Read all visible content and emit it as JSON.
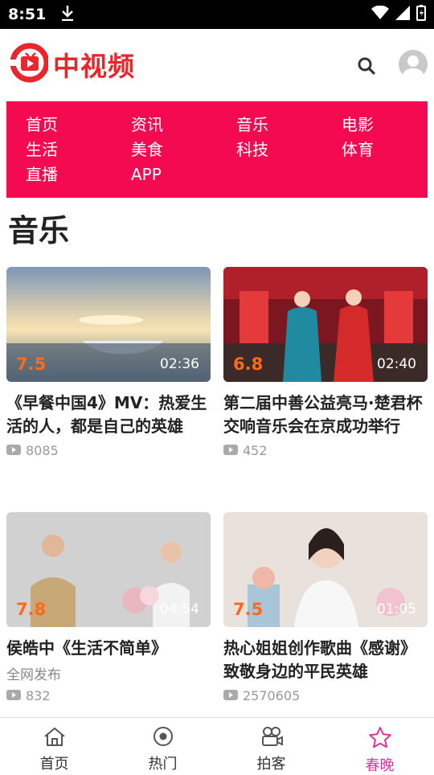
{
  "status": {
    "time": "8:51"
  },
  "app": {
    "name": "中视频"
  },
  "nav": [
    "首页",
    "资讯",
    "音乐",
    "电影",
    "生活",
    "美食",
    "科技",
    "体育",
    "直播",
    "APP"
  ],
  "section": {
    "title": "音乐"
  },
  "videos": [
    {
      "score": "7.5",
      "duration": "02:36",
      "title": "《早餐中国4》MV：热爱生活的人，都是自己的英雄",
      "subtitle": "",
      "views": "8085"
    },
    {
      "score": "6.8",
      "duration": "02:40",
      "title": "第二届中善公益亮马·楚君杯交响音乐会在京成功举行",
      "subtitle": "",
      "views": "452"
    },
    {
      "score": "7.8",
      "duration": "04:54",
      "title": "侯皓中《生活不简单》",
      "subtitle": "全网发布",
      "views": "832"
    },
    {
      "score": "7.5",
      "duration": "01:05",
      "title": "热心姐姐创作歌曲《感谢》致敬身边的平民英雄",
      "subtitle": "",
      "views": "2570605"
    }
  ],
  "tabs": [
    {
      "label": "首页",
      "icon": "home-icon"
    },
    {
      "label": "热门",
      "icon": "hot-icon"
    },
    {
      "label": "拍客",
      "icon": "camera-icon"
    },
    {
      "label": "春晚",
      "icon": "star-icon"
    }
  ],
  "colors": {
    "brand": "#e8262b",
    "nav_bg": "#f40a50",
    "score": "#ff6a1a",
    "active_tab": "#e0349a"
  }
}
